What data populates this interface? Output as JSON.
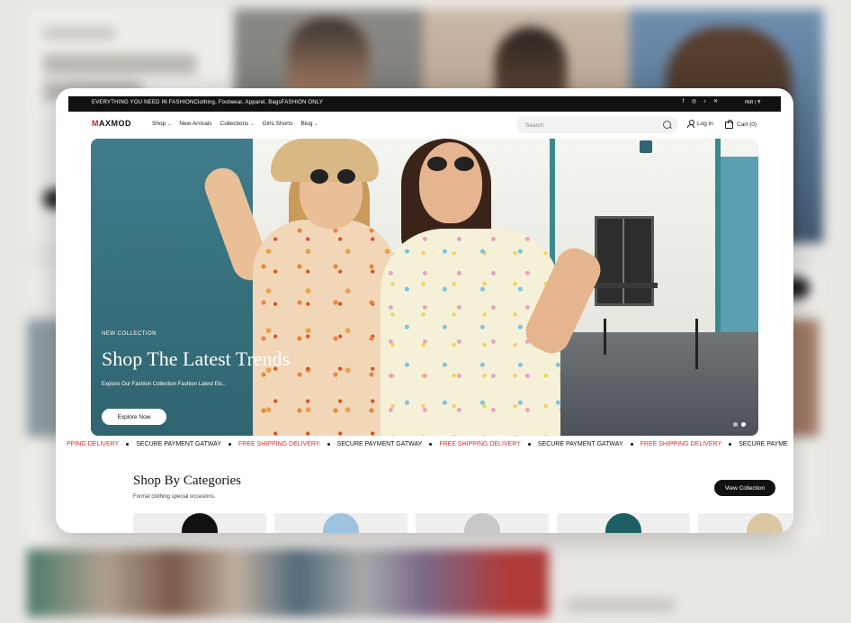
{
  "announcement": {
    "message": "EVERYTHING YOU NEED IN FASHIONClothing, Footwear, Apparel, BagsFASHION ONLY",
    "currency": "INR | ₹"
  },
  "header": {
    "logo_prefix": "M",
    "logo_rest": "AXMOD",
    "nav": [
      {
        "label": "Shop",
        "dropdown": true
      },
      {
        "label": "New Arrivals",
        "dropdown": false
      },
      {
        "label": "Collections",
        "dropdown": true
      },
      {
        "label": "Girls Shorts",
        "dropdown": false
      },
      {
        "label": "Blog",
        "dropdown": true
      }
    ],
    "search_placeholder": "Search",
    "login_label": "Log in",
    "cart_label": "Cart (0)"
  },
  "hero": {
    "eyebrow": "NEW COLLECTION",
    "title": "Shop The Latest Trends",
    "subtitle": "Explore Our Fashion Collection Fashion Latest Etc..",
    "button_label": "Explore Now",
    "slides": 2,
    "active_slide": 2
  },
  "marquee": [
    {
      "text": "PPING DELIVERY",
      "color": "red"
    },
    {
      "text": "SECURE PAYMENT GATWAY",
      "color": "black"
    },
    {
      "text": "FREE SHIPPING DELIVERY",
      "color": "red"
    },
    {
      "text": "SECURE PAYMENT GATWAY",
      "color": "black"
    },
    {
      "text": "FREE SHIPPING DELIVERY",
      "color": "red"
    },
    {
      "text": "SECURE PAYMENT GATWAY",
      "color": "black"
    },
    {
      "text": "FREE SHIPPING DELIVERY",
      "color": "red"
    },
    {
      "text": "SECURE PAYME",
      "color": "black"
    }
  ],
  "categories": {
    "title": "Shop By Categories",
    "subtitle": "Formal clothing special occasions.",
    "button_label": "View Collection",
    "cards": 5
  },
  "colors": {
    "accent_red": "#e02b2b",
    "dark": "#111111",
    "card_bg": "#ffffff"
  },
  "icons": [
    "facebook-icon",
    "instagram-icon",
    "tiktok-icon",
    "x-icon",
    "search-icon",
    "user-icon",
    "cart-icon"
  ]
}
